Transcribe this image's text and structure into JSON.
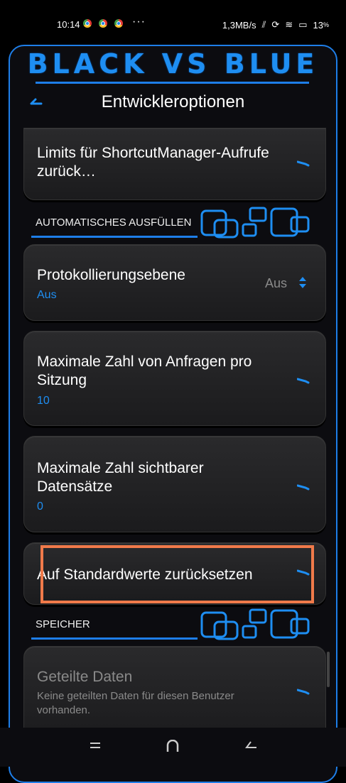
{
  "status_bar": {
    "time": "10:14",
    "dots": "···",
    "speed": "1,3MB/s",
    "battery": "13"
  },
  "brand": {
    "title": "BLACK VS BLUE"
  },
  "header": {
    "title": "Entwickleroptionen"
  },
  "cards": [
    {
      "title": "Limits für ShortcutManager-Aufrufe zurück…"
    },
    {
      "title": "Protokollierungsebene",
      "value": "Aus",
      "selector": "Aus"
    },
    {
      "title": "Maximale Zahl von Anfragen pro Sitzung",
      "value": "10"
    },
    {
      "title": "Maximale Zahl sichtbarer Datensätze",
      "value": "0"
    },
    {
      "title": "Auf Standardwerte zurücksetzen"
    },
    {
      "title": "Geteilte Daten",
      "subtitle": "Keine geteilten Daten für diesen Benutzer vorhanden."
    }
  ],
  "sections": {
    "autofill": "AUTOMATISCHES AUSFÜLLEN",
    "storage": "SPEICHER"
  },
  "colors": {
    "accent": "#1e7ee8",
    "highlight": "#f07a4a",
    "card": "#242426"
  }
}
